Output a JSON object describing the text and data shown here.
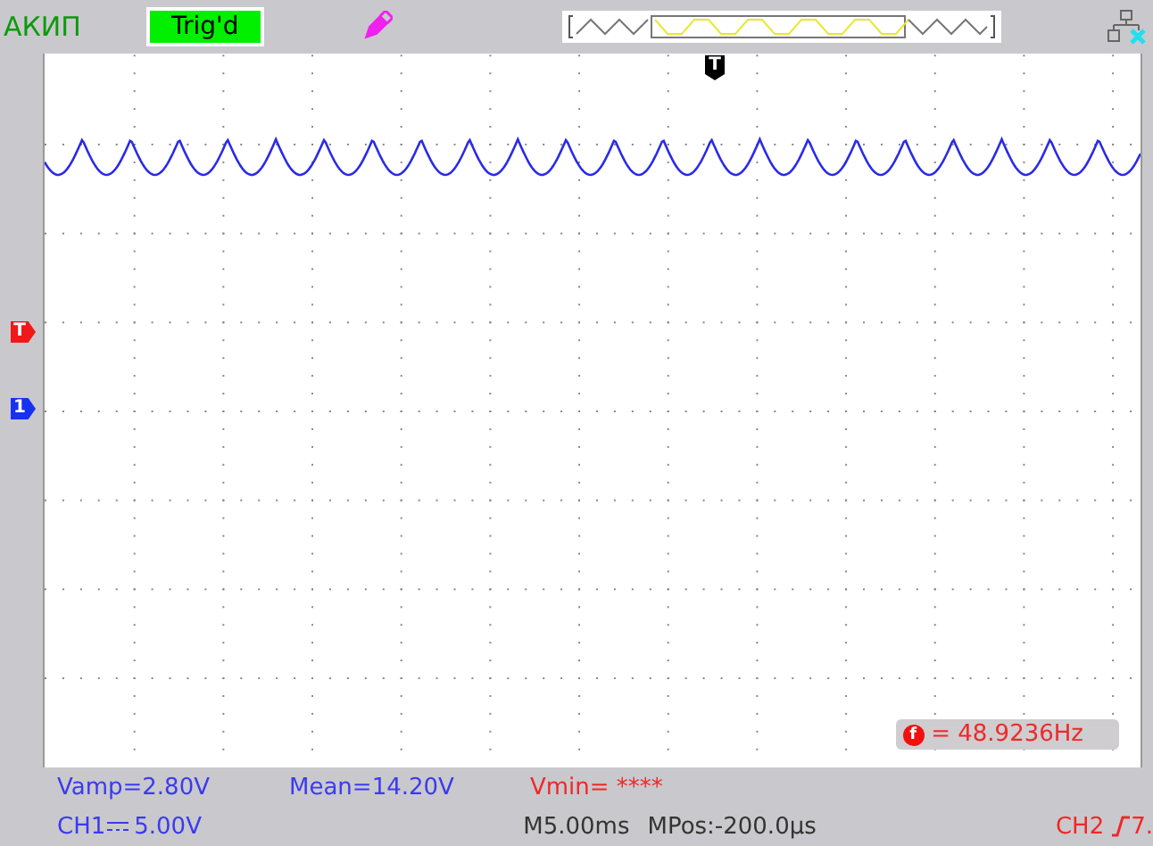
{
  "header": {
    "brand": "АКИП",
    "trigger_status": "Trig'd"
  },
  "markers": {
    "trigger_position": "T",
    "trigger_level": "T",
    "channel": "1"
  },
  "frequency": {
    "badge": "f",
    "reading": "= 48.9236Hz"
  },
  "measurements": [
    {
      "text": "Vamp=2.80V",
      "color": "#3a3af0"
    },
    {
      "text": "Mean=14.20V",
      "color": "#3a3af0"
    },
    {
      "text": "Vmin= ****",
      "color": "#f02828"
    }
  ],
  "status_bar": {
    "channel": "CH1",
    "volts": "5.00V",
    "timebase": "M5.00ms",
    "position": "MPos:-200.0µs",
    "trigger_source": "CH2",
    "trigger_level": "7."
  }
}
